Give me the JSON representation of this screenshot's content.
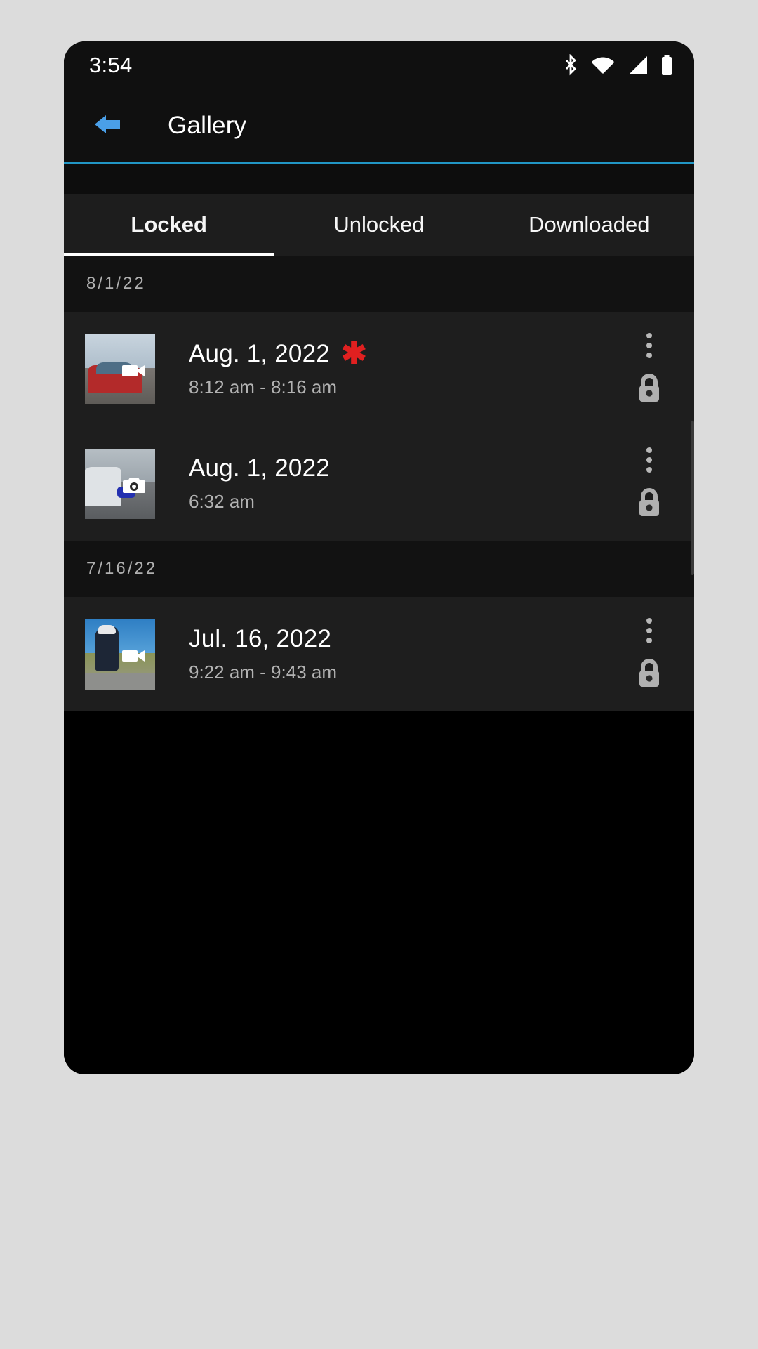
{
  "status_bar": {
    "clock": "3:54",
    "icons": [
      "bluetooth-icon",
      "wifi-icon",
      "cellular-signal-icon",
      "battery-icon"
    ]
  },
  "app_bar": {
    "back_icon": "back-arrow-icon",
    "title": "Gallery",
    "accent_color": "#2196c4"
  },
  "tabs": [
    {
      "label": "Locked",
      "selected": true
    },
    {
      "label": "Unlocked",
      "selected": false
    },
    {
      "label": "Downloaded",
      "selected": false
    }
  ],
  "groups": [
    {
      "date_header": "8/1/22",
      "items": [
        {
          "title": "Aug. 1, 2022",
          "subtitle": "8:12 am - 8:16 am",
          "starred": true,
          "star_glyph": "✱",
          "star_color": "#e02020",
          "media_type": "video",
          "media_badge_icon": "video-camera-icon",
          "menu_icon": "overflow-menu-icon",
          "lock_icon": "lock-closed-icon",
          "thumbnail": {
            "description": "red car on road",
            "sky": "#b9c6d2",
            "ground": "#6d6a66",
            "subject": "#b32a2a"
          }
        },
        {
          "title": "Aug. 1, 2022",
          "subtitle": "6:32 am",
          "starred": false,
          "media_type": "photo",
          "media_badge_icon": "photo-camera-icon",
          "menu_icon": "overflow-menu-icon",
          "lock_icon": "lock-closed-icon",
          "thumbnail": {
            "description": "white SUV on street",
            "sky": "#a9b2b8",
            "ground": "#6a6d70",
            "subject": "#d9dde0"
          }
        }
      ]
    },
    {
      "date_header": "7/16/22",
      "items": [
        {
          "title": "Jul. 16, 2022",
          "subtitle": "9:22 am - 9:43 am",
          "starred": false,
          "media_type": "video",
          "media_badge_icon": "video-camera-icon",
          "menu_icon": "overflow-menu-icon",
          "lock_icon": "lock-closed-icon",
          "thumbnail": {
            "description": "cyclist on road",
            "sky": "#2f7fc4",
            "ground": "#7e8a52",
            "subject": "#1d2636"
          }
        }
      ]
    }
  ]
}
